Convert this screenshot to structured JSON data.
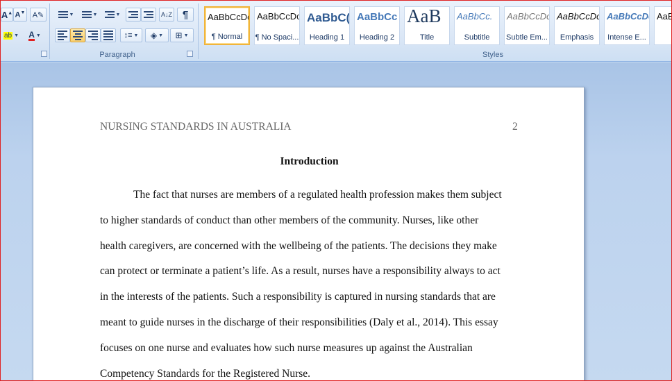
{
  "ribbon": {
    "font_group": {
      "grow_label": "A",
      "shrink_label": "A",
      "font_color_label": "A"
    },
    "paragraph": {
      "label": "Paragraph",
      "sort_label": "A↓Z",
      "pilcrow_label": "¶"
    },
    "styles": {
      "label": "Styles",
      "items": [
        {
          "preview": "AaBbCcDc",
          "name": "¶ Normal"
        },
        {
          "preview": "AaBbCcDc",
          "name": "¶ No Spaci..."
        },
        {
          "preview": "AaBbC(",
          "name": "Heading 1"
        },
        {
          "preview": "AaBbCc",
          "name": "Heading 2"
        },
        {
          "preview": "AaB",
          "name": "Title"
        },
        {
          "preview": "AaBbCc.",
          "name": "Subtitle"
        },
        {
          "preview": "AaBbCcDc",
          "name": "Subtle Em..."
        },
        {
          "preview": "AaBbCcDc",
          "name": "Emphasis"
        },
        {
          "preview": "AaBbCcDc",
          "name": "Intense E..."
        },
        {
          "preview": "AaB",
          "name": "St"
        }
      ]
    }
  },
  "document": {
    "header_title": "NURSING STANDARDS IN AUSTRALIA",
    "header_page": "2",
    "heading": "Introduction",
    "lines": [
      "The fact that nurses are members of a regulated health profession makes them subject",
      "to higher standards of conduct than other members of the community. Nurses, like other",
      "health caregivers, are concerned with the wellbeing of the patients. The decisions they make",
      "can protect or terminate a patient’s life. As a result, nurses have a responsibility always to act",
      "in the interests of the patients. Such a responsibility is captured in nursing standards that are",
      "meant to guide nurses in the discharge of their responsibilities (Daly et al., 2014). This essay",
      "focuses on one nurse and evaluates how such nurse measures up against the Australian",
      "Competency Standards for the Registered Nurse."
    ]
  },
  "colors": {
    "ribbon_bg": "#dbe7f6",
    "ribbon_text": "#3e5f8a",
    "selected_style_border": "#f0b43c",
    "doc_background": "#c5d9f0",
    "frame_border": "#e02020"
  }
}
